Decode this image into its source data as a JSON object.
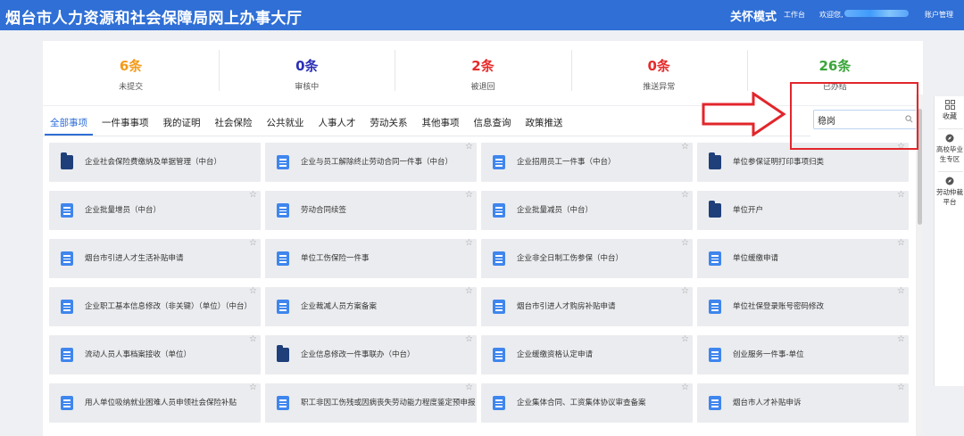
{
  "header": {
    "site_title": "烟台市人力资源和社会保障局网上办事大厅",
    "care_mode": "关怀模式",
    "workbench": "工作台",
    "welcome": "欢迎您,",
    "account": "账户管理"
  },
  "stats": [
    {
      "value": "6条",
      "label": "未提交",
      "color": "#f39b1a"
    },
    {
      "value": "0条",
      "label": "审核中",
      "color": "#2b2fb5"
    },
    {
      "value": "2条",
      "label": "被退回",
      "color": "#e62b2b"
    },
    {
      "value": "0条",
      "label": "推送异常",
      "color": "#e62b2b"
    },
    {
      "value": "26条",
      "label": "已办结",
      "color": "#3aa53a"
    }
  ],
  "tabs": [
    "全部事项",
    "一件事事项",
    "我的证明",
    "社会保险",
    "公共就业",
    "人事人才",
    "劳动关系",
    "其他事项",
    "信息查询",
    "政策推送"
  ],
  "active_tab": "全部事项",
  "search": {
    "value": "稳岗"
  },
  "cards": [
    [
      {
        "label": "企业社会保险费缴纳及单据管理（中台）",
        "icon": "folder-icon",
        "star": false
      },
      {
        "label": "企业与员工解除终止劳动合同一件事（中台）",
        "icon": "document-icon",
        "star": true
      },
      {
        "label": "企业招用员工一件事（中台）",
        "icon": "document-icon",
        "star": true
      },
      {
        "label": "单位参保证明打印事项归类",
        "icon": "folder-icon",
        "star": true
      }
    ],
    [
      {
        "label": "企业批量增员（中台）",
        "icon": "document-icon",
        "star": true
      },
      {
        "label": "劳动合同续签",
        "icon": "document-icon",
        "star": true
      },
      {
        "label": "企业批量减员（中台）",
        "icon": "document-icon",
        "star": true
      },
      {
        "label": "单位开户",
        "icon": "folder-icon",
        "star": true
      }
    ],
    [
      {
        "label": "烟台市引进人才生活补贴申请",
        "icon": "document-icon",
        "star": true
      },
      {
        "label": "单位工伤保险一件事",
        "icon": "document-icon",
        "star": true
      },
      {
        "label": "企业非全日制工伤参保（中台）",
        "icon": "document-icon",
        "star": true
      },
      {
        "label": "单位缓缴申请",
        "icon": "document-icon",
        "star": true
      }
    ],
    [
      {
        "label": "企业职工基本信息修改（非关键）（单位）（中台）",
        "icon": "document-icon",
        "star": true
      },
      {
        "label": "企业裁减人员方案备案",
        "icon": "document-icon",
        "star": true
      },
      {
        "label": "烟台市引进人才购房补贴申请",
        "icon": "document-icon",
        "star": true
      },
      {
        "label": "单位社保登录账号密码修改",
        "icon": "document-icon",
        "star": true
      }
    ],
    [
      {
        "label": "流动人员人事档案接收（单位）",
        "icon": "document-icon",
        "star": true
      },
      {
        "label": "企业信息修改一件事联办（中台）",
        "icon": "folder-icon",
        "star": true
      },
      {
        "label": "企业缓缴资格认定申请",
        "icon": "document-icon",
        "star": true
      },
      {
        "label": "创业服务一件事-单位",
        "icon": "document-icon",
        "star": true
      }
    ],
    [
      {
        "label": "用人单位吸纳就业困难人员申领社会保险补贴",
        "icon": "document-icon",
        "star": true
      },
      {
        "label": "职工非因工伤残或因病丧失劳动能力程度鉴定预申报",
        "icon": "document-icon",
        "star": true
      },
      {
        "label": "企业集体合同、工资集体协议审查备案",
        "icon": "document-icon",
        "star": true
      },
      {
        "label": "烟台市人才补贴申诉",
        "icon": "document-icon",
        "star": true
      }
    ]
  ],
  "dock": [
    {
      "label": "收藏",
      "icon": "grid-icon"
    },
    {
      "label": "高校毕业生专区",
      "icon": "compass-icon"
    },
    {
      "label": "劳动仲裁平台",
      "icon": "compass-icon"
    }
  ],
  "colors": {
    "brand": "#2f6fd6",
    "annotation": "#e2262b"
  }
}
